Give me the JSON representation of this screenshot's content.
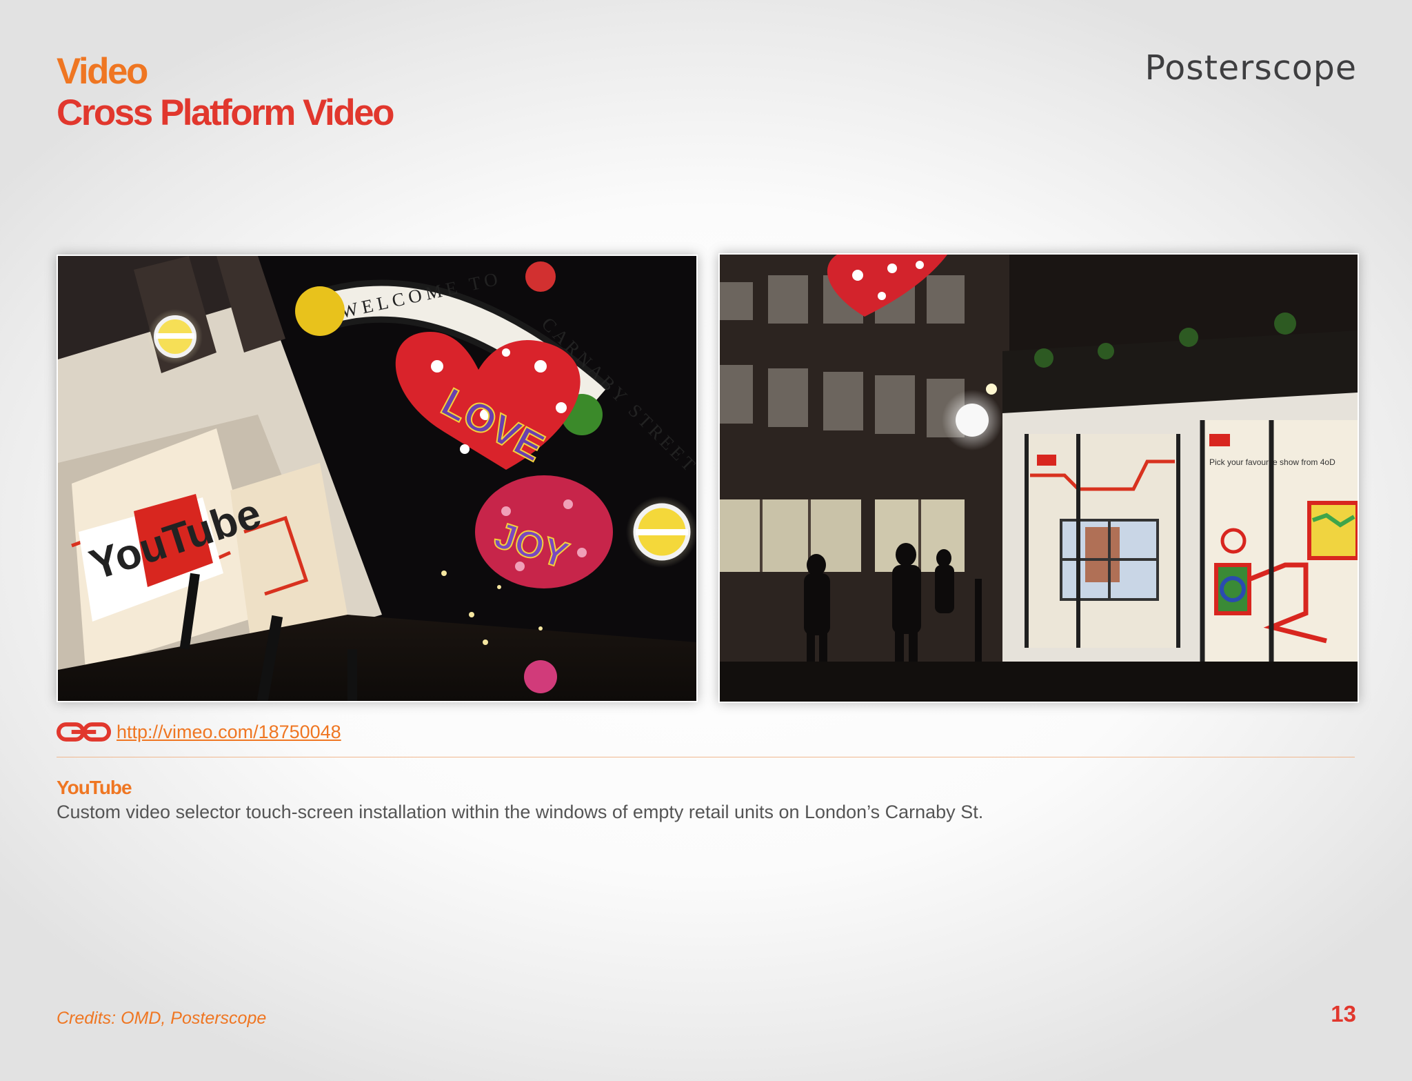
{
  "header": {
    "title_line1": "Video",
    "title_line2": "Cross Platform Video",
    "logo_text": "Posterscope"
  },
  "photos": [
    {
      "name": "carnaby-street-arch-photo",
      "sign_left": "WELCOME TO",
      "sign_right": "CARNABY STREET",
      "balloon_1": "LOVE",
      "balloon_2": "JOY",
      "window_text": "YouTube"
    },
    {
      "name": "retail-window-installation-photo",
      "window_text": "Pick your favourite show from 4oD"
    }
  ],
  "link": {
    "icon": "chain-link-icon",
    "url_text": "http://vimeo.com/18750048"
  },
  "body": {
    "heading": "YouTube",
    "description": "Custom video selector touch-screen installation within the windows of empty retail units on London’s Carnaby St."
  },
  "footer": {
    "credits": "Credits: OMD, Posterscope",
    "page_number": "13"
  },
  "colors": {
    "orange": "#ef7622",
    "red": "#e1372d",
    "logo_grey": "#3e3e40",
    "body_text": "#555555"
  }
}
